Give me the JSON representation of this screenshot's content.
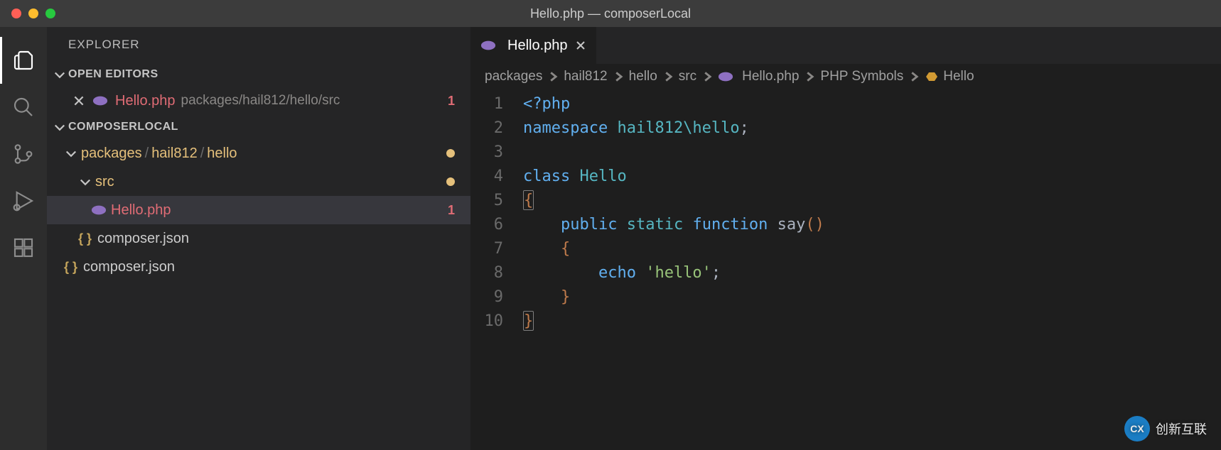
{
  "window": {
    "title": "Hello.php — composerLocal"
  },
  "sidebar": {
    "title": "EXPLORER",
    "sections": {
      "openEditors": {
        "label": "OPEN EDITORS",
        "items": [
          {
            "name": "Hello.php",
            "path": "packages/hail812/hello/src",
            "problems": "1"
          }
        ]
      },
      "workspace": {
        "label": "COMPOSERLOCAL",
        "tree": {
          "packagesPath": {
            "seg1": "packages",
            "seg2": "hail812",
            "seg3": "hello"
          },
          "src": {
            "label": "src"
          },
          "helloPhp": {
            "label": "Hello.php",
            "problems": "1"
          },
          "innerComposer": {
            "label": "composer.json"
          },
          "outerComposer": {
            "label": "composer.json"
          }
        }
      }
    }
  },
  "editor": {
    "tab": {
      "label": "Hello.php"
    },
    "breadcrumb": {
      "packages": "packages",
      "hail812": "hail812",
      "hello": "hello",
      "src": "src",
      "file": "Hello.php",
      "phpSymbols": "PHP Symbols",
      "className": "Hello"
    },
    "code": {
      "lineNumbers": [
        "1",
        "2",
        "3",
        "4",
        "5",
        "6",
        "7",
        "8",
        "9",
        "10"
      ],
      "l1_tag": "<?php",
      "l2_kw": "namespace",
      "l2_ns": "hail812\\hello",
      "l4_kw": "class",
      "l4_cls": "Hello",
      "l6_public": "public",
      "l6_static": "static",
      "l6_function": "function",
      "l6_name": "say",
      "l8_echo": "echo",
      "l8_str": "'hello'"
    }
  },
  "watermark": {
    "logo": "CX",
    "text": "创新互联"
  }
}
